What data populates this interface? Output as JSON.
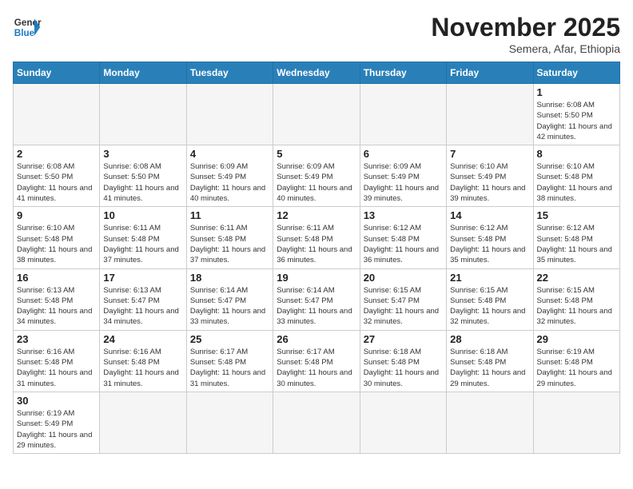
{
  "header": {
    "logo_general": "General",
    "logo_blue": "Blue",
    "month_title": "November 2025",
    "location": "Semera, Afar, Ethiopia"
  },
  "weekdays": [
    "Sunday",
    "Monday",
    "Tuesday",
    "Wednesday",
    "Thursday",
    "Friday",
    "Saturday"
  ],
  "weeks": [
    [
      {
        "day": "",
        "info": ""
      },
      {
        "day": "",
        "info": ""
      },
      {
        "day": "",
        "info": ""
      },
      {
        "day": "",
        "info": ""
      },
      {
        "day": "",
        "info": ""
      },
      {
        "day": "",
        "info": ""
      },
      {
        "day": "1",
        "info": "Sunrise: 6:08 AM\nSunset: 5:50 PM\nDaylight: 11 hours and 42 minutes."
      }
    ],
    [
      {
        "day": "2",
        "info": "Sunrise: 6:08 AM\nSunset: 5:50 PM\nDaylight: 11 hours and 41 minutes."
      },
      {
        "day": "3",
        "info": "Sunrise: 6:08 AM\nSunset: 5:50 PM\nDaylight: 11 hours and 41 minutes."
      },
      {
        "day": "4",
        "info": "Sunrise: 6:09 AM\nSunset: 5:49 PM\nDaylight: 11 hours and 40 minutes."
      },
      {
        "day": "5",
        "info": "Sunrise: 6:09 AM\nSunset: 5:49 PM\nDaylight: 11 hours and 40 minutes."
      },
      {
        "day": "6",
        "info": "Sunrise: 6:09 AM\nSunset: 5:49 PM\nDaylight: 11 hours and 39 minutes."
      },
      {
        "day": "7",
        "info": "Sunrise: 6:10 AM\nSunset: 5:49 PM\nDaylight: 11 hours and 39 minutes."
      },
      {
        "day": "8",
        "info": "Sunrise: 6:10 AM\nSunset: 5:48 PM\nDaylight: 11 hours and 38 minutes."
      }
    ],
    [
      {
        "day": "9",
        "info": "Sunrise: 6:10 AM\nSunset: 5:48 PM\nDaylight: 11 hours and 38 minutes."
      },
      {
        "day": "10",
        "info": "Sunrise: 6:11 AM\nSunset: 5:48 PM\nDaylight: 11 hours and 37 minutes."
      },
      {
        "day": "11",
        "info": "Sunrise: 6:11 AM\nSunset: 5:48 PM\nDaylight: 11 hours and 37 minutes."
      },
      {
        "day": "12",
        "info": "Sunrise: 6:11 AM\nSunset: 5:48 PM\nDaylight: 11 hours and 36 minutes."
      },
      {
        "day": "13",
        "info": "Sunrise: 6:12 AM\nSunset: 5:48 PM\nDaylight: 11 hours and 36 minutes."
      },
      {
        "day": "14",
        "info": "Sunrise: 6:12 AM\nSunset: 5:48 PM\nDaylight: 11 hours and 35 minutes."
      },
      {
        "day": "15",
        "info": "Sunrise: 6:12 AM\nSunset: 5:48 PM\nDaylight: 11 hours and 35 minutes."
      }
    ],
    [
      {
        "day": "16",
        "info": "Sunrise: 6:13 AM\nSunset: 5:48 PM\nDaylight: 11 hours and 34 minutes."
      },
      {
        "day": "17",
        "info": "Sunrise: 6:13 AM\nSunset: 5:47 PM\nDaylight: 11 hours and 34 minutes."
      },
      {
        "day": "18",
        "info": "Sunrise: 6:14 AM\nSunset: 5:47 PM\nDaylight: 11 hours and 33 minutes."
      },
      {
        "day": "19",
        "info": "Sunrise: 6:14 AM\nSunset: 5:47 PM\nDaylight: 11 hours and 33 minutes."
      },
      {
        "day": "20",
        "info": "Sunrise: 6:15 AM\nSunset: 5:47 PM\nDaylight: 11 hours and 32 minutes."
      },
      {
        "day": "21",
        "info": "Sunrise: 6:15 AM\nSunset: 5:48 PM\nDaylight: 11 hours and 32 minutes."
      },
      {
        "day": "22",
        "info": "Sunrise: 6:15 AM\nSunset: 5:48 PM\nDaylight: 11 hours and 32 minutes."
      }
    ],
    [
      {
        "day": "23",
        "info": "Sunrise: 6:16 AM\nSunset: 5:48 PM\nDaylight: 11 hours and 31 minutes."
      },
      {
        "day": "24",
        "info": "Sunrise: 6:16 AM\nSunset: 5:48 PM\nDaylight: 11 hours and 31 minutes."
      },
      {
        "day": "25",
        "info": "Sunrise: 6:17 AM\nSunset: 5:48 PM\nDaylight: 11 hours and 31 minutes."
      },
      {
        "day": "26",
        "info": "Sunrise: 6:17 AM\nSunset: 5:48 PM\nDaylight: 11 hours and 30 minutes."
      },
      {
        "day": "27",
        "info": "Sunrise: 6:18 AM\nSunset: 5:48 PM\nDaylight: 11 hours and 30 minutes."
      },
      {
        "day": "28",
        "info": "Sunrise: 6:18 AM\nSunset: 5:48 PM\nDaylight: 11 hours and 29 minutes."
      },
      {
        "day": "29",
        "info": "Sunrise: 6:19 AM\nSunset: 5:48 PM\nDaylight: 11 hours and 29 minutes."
      }
    ],
    [
      {
        "day": "30",
        "info": "Sunrise: 6:19 AM\nSunset: 5:49 PM\nDaylight: 11 hours and 29 minutes."
      },
      {
        "day": "",
        "info": ""
      },
      {
        "day": "",
        "info": ""
      },
      {
        "day": "",
        "info": ""
      },
      {
        "day": "",
        "info": ""
      },
      {
        "day": "",
        "info": ""
      },
      {
        "day": "",
        "info": ""
      }
    ]
  ]
}
